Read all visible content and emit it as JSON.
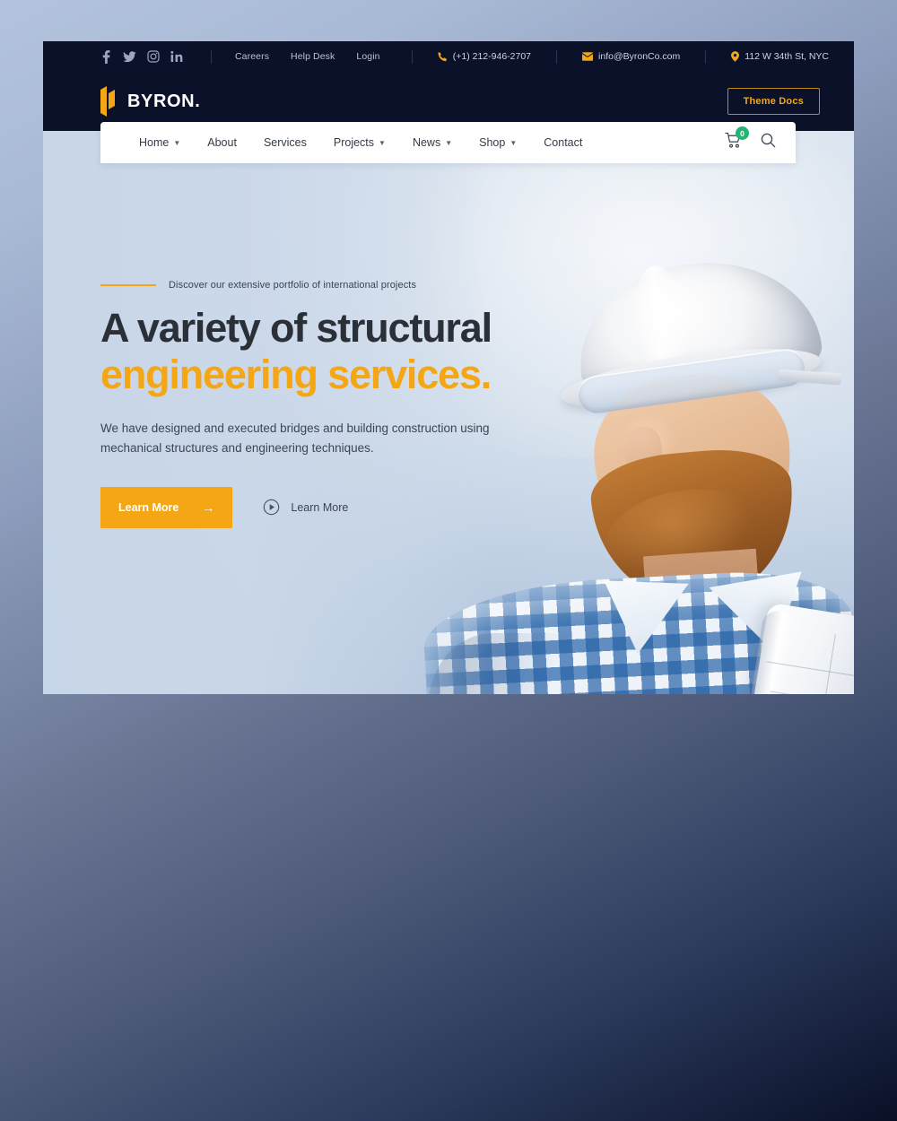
{
  "topbar": {
    "social": [
      {
        "name": "facebook-icon",
        "label": "Facebook"
      },
      {
        "name": "twitter-icon",
        "label": "Twitter"
      },
      {
        "name": "instagram-icon",
        "label": "Instagram"
      },
      {
        "name": "linkedin-icon",
        "label": "LinkedIn"
      }
    ],
    "links": [
      {
        "label": "Careers"
      },
      {
        "label": "Help Desk"
      },
      {
        "label": "Login"
      }
    ],
    "contacts": [
      {
        "icon": "phone-icon",
        "text": "(+1) 212-946-2707"
      },
      {
        "icon": "envelope-icon",
        "text": "info@ByronCo.com"
      },
      {
        "icon": "location-pin-icon",
        "text": "112 W 34th St, NYC"
      }
    ]
  },
  "header": {
    "logo_text": "BYRON.",
    "docs_button": "Theme Docs"
  },
  "nav": {
    "items": [
      {
        "label": "Home",
        "has_dropdown": true
      },
      {
        "label": "About",
        "has_dropdown": false
      },
      {
        "label": "Services",
        "has_dropdown": false
      },
      {
        "label": "Projects",
        "has_dropdown": true
      },
      {
        "label": "News",
        "has_dropdown": true
      },
      {
        "label": "Shop",
        "has_dropdown": true
      },
      {
        "label": "Contact",
        "has_dropdown": false
      }
    ],
    "cart_count": "0",
    "search_icon": "search-icon",
    "cart_icon": "shopping-cart-icon"
  },
  "hero": {
    "eyebrow": "Discover our extensive portfolio of international projects",
    "heading_line1": "A variety of structural",
    "heading_line2": "engineering services.",
    "paragraph": "We have designed and executed bridges and building construction using mechanical structures and engineering techniques.",
    "primary_cta": "Learn More",
    "video_cta": "Learn More"
  },
  "colors": {
    "accent": "#f5a615",
    "dark_navy": "#0a1128",
    "badge_green": "#22b573",
    "nav_panel": "#ffffff"
  }
}
